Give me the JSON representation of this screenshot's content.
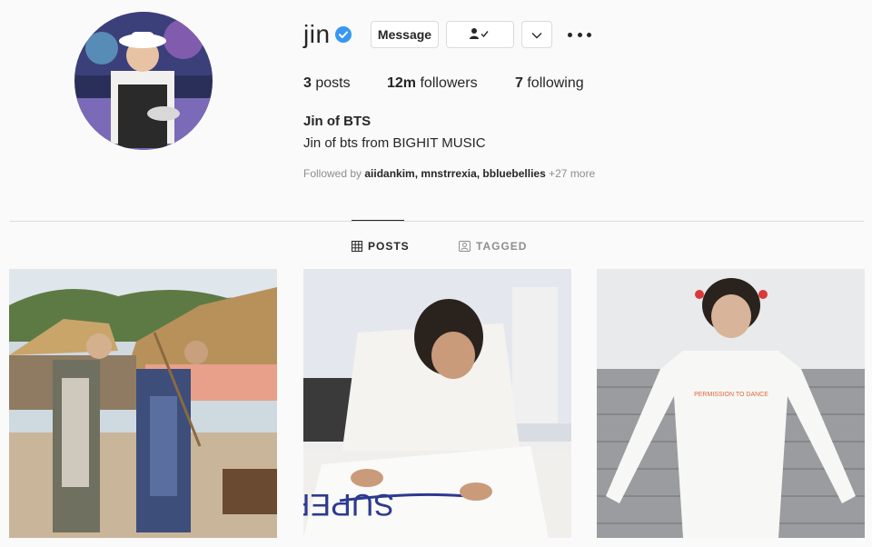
{
  "profile": {
    "username": "jin",
    "full_name": "Jin of BTS",
    "bio": "Jin of bts from BIGHIT MUSIC",
    "verified": true
  },
  "actions": {
    "message_label": "Message"
  },
  "stats": {
    "posts_count": "3",
    "posts_label": "posts",
    "followers_count": "12m",
    "followers_label": "followers",
    "following_count": "7",
    "following_label": "following"
  },
  "followed_by": {
    "prefix": "Followed by",
    "names": "aiidankim, mnstrrexia, bbluebellies",
    "more": "+27 more"
  },
  "tabs": [
    {
      "label": "POSTS",
      "active": true
    },
    {
      "label": "TAGGED",
      "active": false
    }
  ],
  "posts": [
    {
      "description": "two men in traditional hanbok at a village set"
    },
    {
      "description": "man writing on a white shirt",
      "shirt_text": "SUPER"
    },
    {
      "description": "man in white long-sleeve shirt",
      "shirt_text": "PERMISSION TO DANCE"
    }
  ],
  "colors": {
    "verified_blue": "#3897f0",
    "text": "#262626",
    "muted": "#8e8e8e",
    "border": "#dbdbdb"
  }
}
